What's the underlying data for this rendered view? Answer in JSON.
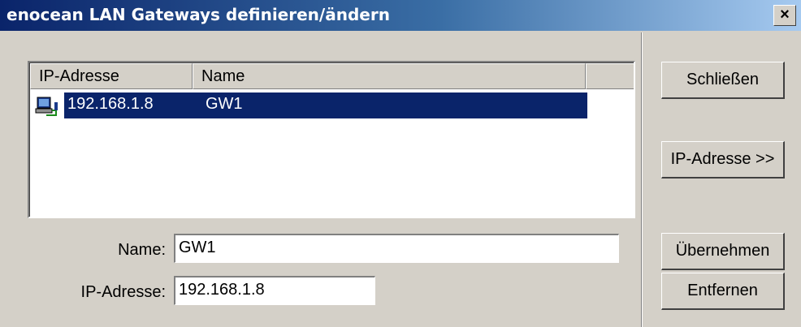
{
  "window": {
    "title": "enocean LAN Gateways definieren/ändern",
    "close_label": "×"
  },
  "list": {
    "columns": [
      "IP-Adresse",
      "Name"
    ],
    "rows": [
      {
        "ip": "192.168.1.8",
        "name": "GW1",
        "icon": "network-computer-icon",
        "selected": true
      }
    ]
  },
  "form": {
    "name_label": "Name:",
    "name_value": "GW1",
    "ip_label": "IP-Adresse:",
    "ip_value": "192.168.1.8"
  },
  "buttons": {
    "close": "Schließen",
    "ip": "IP-Adresse >>",
    "apply": "Übernehmen",
    "remove": "Entfernen"
  },
  "colors": {
    "title_gradient_start": "#0a246a",
    "title_gradient_end": "#a6caf0",
    "selection": "#0a246a",
    "face": "#d4d0c8"
  }
}
